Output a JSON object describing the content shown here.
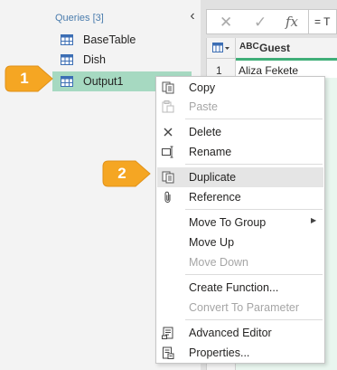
{
  "queries": {
    "header": "Queries [3]",
    "collapse_glyph": "‹",
    "items": [
      {
        "label": "BaseTable"
      },
      {
        "label": "Dish"
      },
      {
        "label": "Output1"
      }
    ]
  },
  "formula_bar": {
    "cancel_glyph": "✕",
    "confirm_glyph": "✓",
    "fx_glyph": "fx",
    "formula_text": "= T"
  },
  "grid": {
    "column_type": "ABC",
    "column_name": "Guest",
    "row_number": "1",
    "cell_value": "Aliza Fekete"
  },
  "context_menu": {
    "copy": "Copy",
    "paste": "Paste",
    "delete": "Delete",
    "rename": "Rename",
    "duplicate": "Duplicate",
    "reference": "Reference",
    "move_to_group": "Move To Group",
    "move_up": "Move Up",
    "move_down": "Move Down",
    "create_function": "Create Function...",
    "convert_to_parameter": "Convert To Parameter",
    "advanced_editor": "Advanced Editor",
    "properties": "Properties..."
  },
  "callouts": {
    "first": "1",
    "second": "2"
  },
  "colors": {
    "selected_query": "#a6d9c1",
    "callout": "#f5a623",
    "accent_green": "#3fae78"
  }
}
